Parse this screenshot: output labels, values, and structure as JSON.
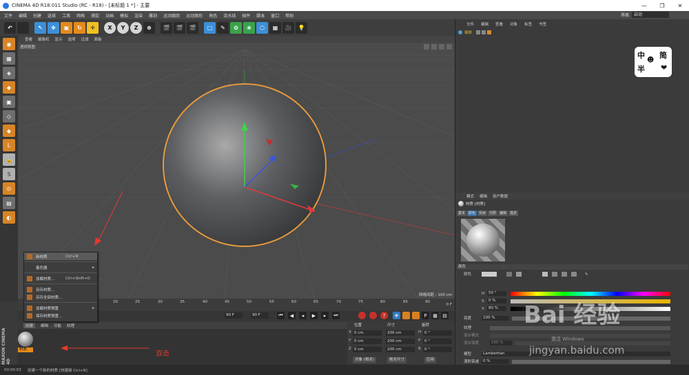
{
  "window": {
    "title": "CINEMA 4D R18.011 Studio (RC - R18) - [未标题 1 *] - 主要",
    "controls": [
      "—",
      "❐",
      "✕"
    ]
  },
  "menubar": {
    "items": [
      "文件",
      "编辑",
      "创建",
      "选择",
      "工具",
      "网格",
      "捕捉",
      "动画",
      "模拟",
      "渲染",
      "雕刻",
      "运动跟踪",
      "运动图形",
      "角色",
      "流水线",
      "插件",
      "脚本",
      "窗口",
      "帮助"
    ],
    "layout_label": "界面",
    "layout_value": "启动"
  },
  "toolbar": {
    "buttons": [
      "↶",
      "",
      "↖",
      "✥",
      "▣",
      "↻",
      "✛",
      "X",
      "Y",
      "Z",
      "⊕",
      "🎬",
      "🎬",
      "🎬",
      "▢",
      "✎",
      "✿",
      "❀",
      "⬡",
      "▦",
      "🎥",
      "💡"
    ]
  },
  "left_toolbar": {
    "buttons": [
      "◉",
      "▦",
      "◈",
      "◆",
      "▣",
      "◇",
      "◆",
      "L",
      "🔒",
      "S",
      "⊙",
      "▤",
      "◐"
    ]
  },
  "viewport": {
    "menu": [
      "查看",
      "摄像机",
      "显示",
      "选项",
      "过滤",
      "面板"
    ],
    "label": "透视视图",
    "grid_info": "网格间距 : 100 cm"
  },
  "context_menu": {
    "items": [
      {
        "label": "新材质",
        "shortcut": "Ctrl+N",
        "active": true
      },
      {
        "label": "着色器",
        "submenu": true
      },
      {
        "label": "加载材质...",
        "shortcut": "Ctrl+Shift+O"
      },
      {
        "label": "另存材质..."
      },
      {
        "label": "另存全部材质..."
      },
      {
        "label": "加载材质预置",
        "submenu": true
      },
      {
        "label": "保存材质预置..."
      }
    ]
  },
  "timeline": {
    "ticks": [
      "0",
      "5",
      "10",
      "15",
      "20",
      "25",
      "30",
      "35",
      "40",
      "45",
      "50",
      "55",
      "60",
      "65",
      "70",
      "75",
      "80",
      "85",
      "90"
    ],
    "end_frame": "0 F",
    "field_90": "90 F",
    "field_90b": "90 F"
  },
  "material_manager": {
    "menu": [
      "创建",
      "编辑",
      "功能",
      "纹理"
    ],
    "material_name": "材质"
  },
  "coords": {
    "headers": [
      "位置",
      "尺寸",
      "旋转"
    ],
    "rows": [
      {
        "axis": "X",
        "pos": "0 cm",
        "size": "200 cm",
        "rot_axis": "H",
        "rot": "0 °"
      },
      {
        "axis": "Y",
        "pos": "0 cm",
        "size": "200 cm",
        "rot_axis": "P",
        "rot": "0 °"
      },
      {
        "axis": "Z",
        "pos": "0 cm",
        "size": "200 cm",
        "rot_axis": "B",
        "rot": "0 °"
      }
    ],
    "mode": "对象 (相对)",
    "size_mode": "绝对尺寸",
    "apply": "应用"
  },
  "status": {
    "time": "00:00:03",
    "message": "创建一个新的材质 [快捷键 Ctrl+N]"
  },
  "object_manager": {
    "menu": [
      "文件",
      "编辑",
      "查看",
      "对象",
      "标签",
      "书签"
    ],
    "object_name": "球体"
  },
  "logo": {
    "chars": [
      "中",
      "半",
      "简"
    ]
  },
  "attributes": {
    "menu": [
      "模式",
      "编辑",
      "用户数据"
    ],
    "title": "材质 [材质]",
    "tabs": [
      "基本",
      "颜色",
      "反射",
      "光照",
      "编辑",
      "指定"
    ],
    "section_color": "颜色",
    "color_label": "颜色",
    "h_label": "H",
    "h_value": "50 °",
    "s_label": "S",
    "s_value": "0 %",
    "v_label": "V",
    "v_value": "80 %",
    "brightness_label": "亮度",
    "brightness_value": "100 %",
    "texture_label": "纹理",
    "mix_mode_label": "混合模式",
    "mix_strength_label": "混合强度",
    "mix_strength_value": "100 %",
    "model_label": "模型",
    "model_value": "Lambertian",
    "diffuse_label": "漫射衰减",
    "diffuse_value": "0 %"
  },
  "annotation": "双击",
  "watermark": {
    "brand": "Bai 经验",
    "url": "jingyan.baidu.com",
    "activate": "激活 Windows"
  }
}
